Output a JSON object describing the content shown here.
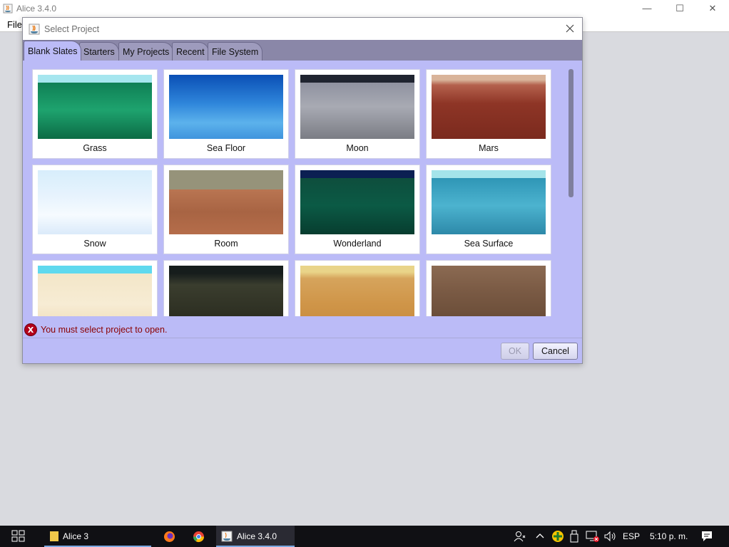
{
  "app": {
    "title": "Alice 3.4.0",
    "menu": {
      "file": "File"
    },
    "controls": {
      "minimize": "—",
      "maximize": "☐",
      "close": "✕"
    }
  },
  "dialog": {
    "title": "Select Project",
    "tabs": [
      "Blank Slates",
      "Starters",
      "My Projects",
      "Recent",
      "File System"
    ],
    "active_tab": "Blank Slates",
    "templates": [
      {
        "label": "Grass"
      },
      {
        "label": "Sea Floor"
      },
      {
        "label": "Moon"
      },
      {
        "label": "Mars"
      },
      {
        "label": "Snow"
      },
      {
        "label": "Room"
      },
      {
        "label": "Wonderland"
      },
      {
        "label": "Sea Surface"
      }
    ],
    "error_icon": "X",
    "error_message": "You must select project to open.",
    "buttons": {
      "ok": "OK",
      "cancel": "Cancel"
    }
  },
  "taskbar": {
    "items": [
      {
        "label": "Alice 3",
        "icon": "folder-icon"
      },
      {
        "label": "Alice 3.4.0",
        "icon": "java-icon"
      }
    ],
    "tray": {
      "language": "ESP",
      "time": "5:10 p. m."
    }
  },
  "colors": {
    "dialog_bg": "#bbbbf7",
    "tab_strip": "#8a87a8",
    "error": "#8b0000",
    "taskbar": "#101014"
  }
}
